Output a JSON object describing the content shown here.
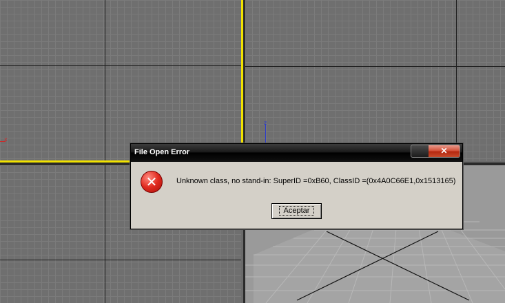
{
  "dialog": {
    "title": "File Open Error",
    "close_symbol": "✕",
    "icon": "error-icon",
    "icon_symbol": "✕",
    "message": "Unknown class, no stand-in: SuperID =0xB60, ClassID =(0x4A0C66E1,0x1513165)",
    "ok_label": "Aceptar"
  },
  "viewports": {
    "axis_x": "x",
    "axis_z": "z"
  },
  "colors": {
    "active_frame": "#f1e200",
    "viewport_bg": "#6f6f6f",
    "dialog_bg": "#d4d0c8",
    "close_button": "#c64a2c"
  }
}
